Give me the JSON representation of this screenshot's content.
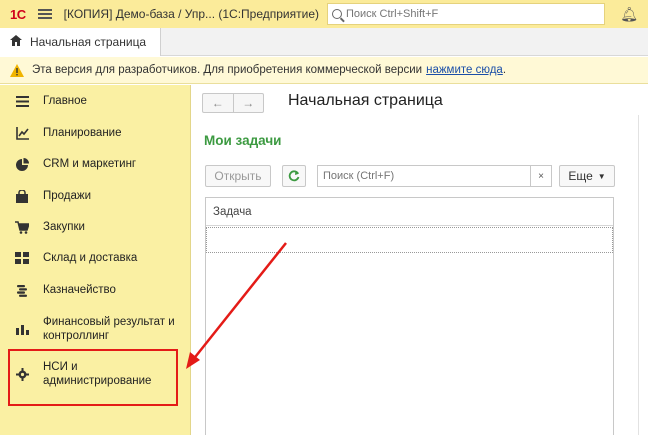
{
  "titlebar": {
    "logo": "1С",
    "title": "[КОПИЯ] Демо-база / Упр...  (1С:Предприятие)",
    "search_placeholder": "Поиск Ctrl+Shift+F"
  },
  "tabs": {
    "home_label": "Начальная страница"
  },
  "warning": {
    "text": "Эта версия для разработчиков. Для приобретения коммерческой версии",
    "link": "нажмите сюда",
    "suffix": "."
  },
  "sidebar": {
    "items": [
      {
        "label": "Главное",
        "icon": "menu-lines-icon"
      },
      {
        "label": "Планирование",
        "icon": "planning-chart-icon"
      },
      {
        "label": "CRM и маркетинг",
        "icon": "pie-chart-icon"
      },
      {
        "label": "Продажи",
        "icon": "shopping-bag-icon"
      },
      {
        "label": "Закупки",
        "icon": "shopping-cart-icon"
      },
      {
        "label": "Склад и доставка",
        "icon": "warehouse-grid-icon"
      },
      {
        "label": "Казначейство",
        "icon": "coins-icon"
      },
      {
        "label": "Финансовый результат и контроллинг",
        "icon": "bar-chart-icon"
      },
      {
        "label": "НСИ и администрирование",
        "icon": "gear-icon"
      }
    ]
  },
  "main": {
    "page_title": "Начальная страница",
    "section_title": "Мои задачи",
    "open_button": "Открыть",
    "search_placeholder": "Поиск (Ctrl+F)",
    "clear_label": "×",
    "more_button": "Еще",
    "table": {
      "columns": [
        "Задача"
      ],
      "rows": []
    }
  },
  "colors": {
    "sidebar_bg": "#faf0a3",
    "titlebar_bg": "#fbeb9a",
    "section_title": "#3c9a41",
    "annotation": "#e41b17"
  }
}
